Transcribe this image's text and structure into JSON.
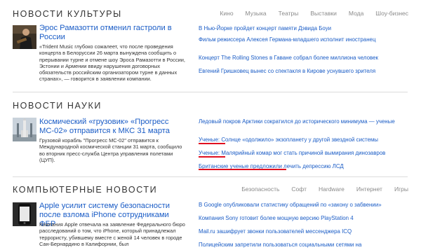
{
  "culture": {
    "title": "НОВОСТИ КУЛЬТУРЫ",
    "tabs": [
      "Кино",
      "Музыка",
      "Театры",
      "Выставки",
      "Мода",
      "Шоу-бизнес"
    ],
    "lead_title": "Эрос Рамазотти отменил гастроли в России",
    "lead_text": "«Trident Music глубоко сожалеет, что после проведения концерта в Белоруссии 26 марта вынуждена сообщить о прерывании турне и отмене шоу Эроса Рамазотти в России, Эстонии и Армении ввиду нарушения договорных обязательств российским организатором турне в данных странах», — говорится в заявлении компании.",
    "items": [
      "В Нью-Йорке пройдет концерт памяти Дэвида Боуи",
      "Фильм режиссера Алексея Германа-младшего исполнит иностранец",
      "Концерт The Rolling Stones в Гаване собрал более миллиона человек",
      "Евгений Гришковец вынес со спектакля в Кирове уснувшего зрителя"
    ]
  },
  "science": {
    "title": "НОВОСТИ НАУКИ",
    "lead_title": "Космический «грузовик» «Прогресс МС-02» отправится к МКС 31 марта",
    "lead_text": "Грузовой корабль \"Прогресс МС-02\" отправится к Международной космической станции 31 марта, сообщило во вторник пресс-служба Центра управления полетами (ЦУП).",
    "items": [
      "Ледовый покров Арктики сократился до исторического минимума — ученые",
      "Ученые: Солнце «одолжило» экзопланету у другой звездной системы",
      "Ученые: Малярийный комар мог стать причиной вымирания динозавров",
      "Британские ученые предложили лечить депрессию ЛСД"
    ]
  },
  "computer": {
    "title": "КОМПЬЮТЕРНЫЕ НОВОСТИ",
    "tabs": [
      "Безопасность",
      "Софт",
      "Hardware",
      "Интернет",
      "Игры"
    ],
    "lead_title": "Apple усилит систему безопасности после взлома iPhone сотрудниками ФБР",
    "lead_text": "Компания Apple отвечала на заявление Федерального бюро расследований о том, что iPhone, который принадлежал террористу, убившему вместе с женой 14 человек в городе Сан-Бернардино в Калифорнии, был",
    "items": [
      "В Google опубликовали статистику обращений по «закону о забвении»",
      "Компания Sony готовит более мощную версию PlayStation 4",
      "Mail.ru зашифрует звонки пользователей мессенджера ICQ",
      "Полицейским запретили пользоваться социальными сетями на"
    ]
  },
  "colors": {
    "link": "#1a5cc6",
    "underline": "#e01020",
    "tab": "#8a8a8a"
  },
  "icons": [
    "singer-photo",
    "rocket-photo",
    "phone-photo"
  ]
}
